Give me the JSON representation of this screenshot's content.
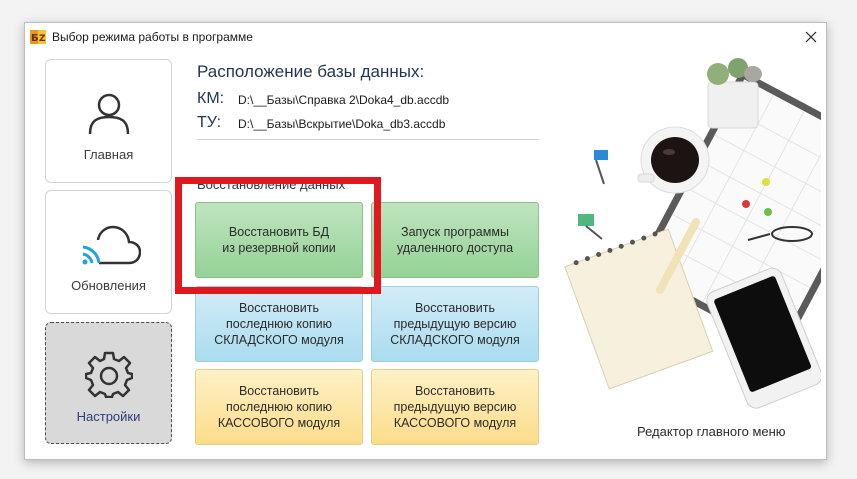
{
  "window": {
    "title": "Выбор режима работы в программе"
  },
  "sidebar": {
    "items": [
      {
        "label": "Главная",
        "icon": "user-icon"
      },
      {
        "label": "Обновления",
        "icon": "cloud-update-icon"
      },
      {
        "label": "Настройки",
        "icon": "gear-icon"
      }
    ]
  },
  "database": {
    "title": "Расположение базы данных:",
    "km_label": "КМ:",
    "km_path": "D:\\__Базы\\Справка 2\\Doka4_db.accdb",
    "tu_label": "ТУ:",
    "tu_path": "D:\\__Базы\\Вскрытие\\Doka_db3.accdb"
  },
  "restore": {
    "section_title": "Восстановление данных",
    "buttons": [
      "Восстановить БД\nиз резервной копии",
      "Запуск программы\nудаленного доступа",
      "Восстановить\nпоследнюю копию\nСКЛАДСКОГО модуля",
      "Восстановить\nпредыдущую версию\nСКЛАДСКОГО модуля",
      "Восстановить\nпоследнюю копию\nКАССОВОГО модуля",
      "Восстановить\nпредыдущую версию\nКАССОВОГО модуля"
    ]
  },
  "footer": {
    "editor_link": "Редактор главного меню"
  },
  "colors": {
    "highlight": "#e0191e",
    "green_button": "#a8dcaa",
    "blue_button": "#bfe5f4",
    "yellow_button": "#fde5a4"
  }
}
